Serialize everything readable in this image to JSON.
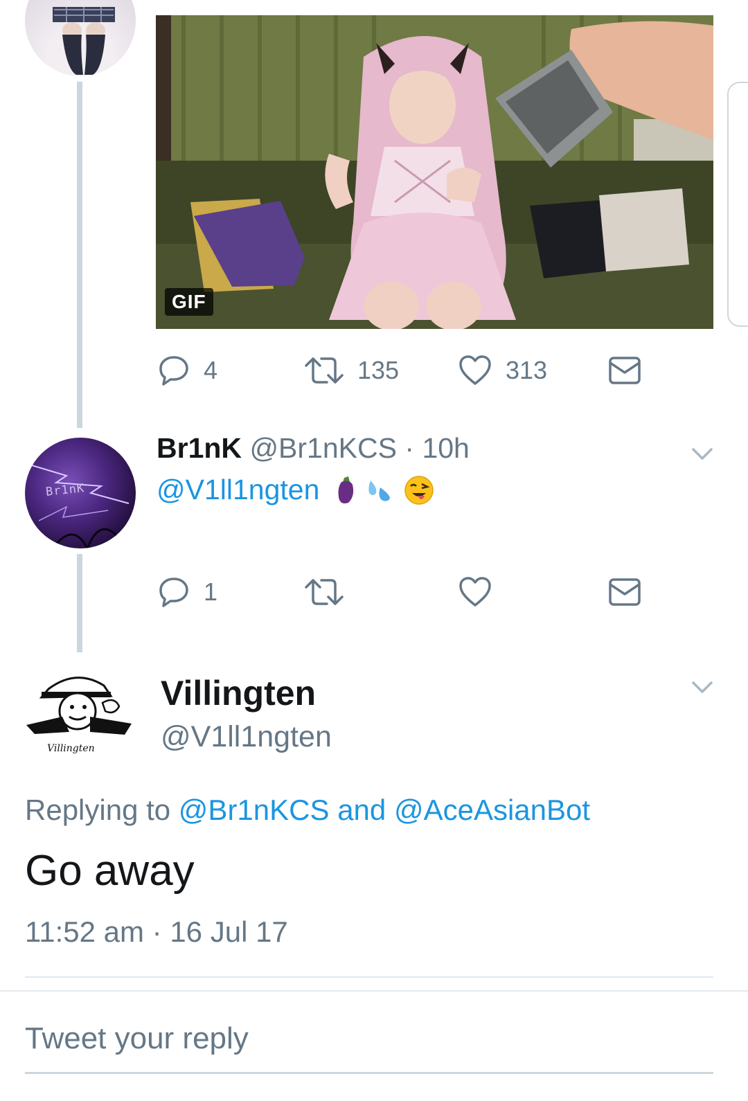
{
  "media": {
    "badge": "GIF",
    "stats": {
      "replies": "4",
      "retweets": "135",
      "likes": "313"
    }
  },
  "reply_tweet": {
    "display_name": "Br1nK",
    "handle": "@Br1nKCS",
    "separator": "·",
    "time": "10h",
    "text": "@V1ll1ngten",
    "emojis": [
      "eggplant",
      "sweat-droplets",
      "winking-face-tongue"
    ],
    "avatar_text": "Br1nK",
    "stats": {
      "replies": "1"
    }
  },
  "main_tweet": {
    "display_name": "Villingten",
    "handle": "@V1ll1ngten",
    "avatar_caption": "Villingten",
    "replying_prefix": "Replying to",
    "replying_user1": "@Br1nKCS",
    "replying_and": "and",
    "replying_user2": "@AceAsianBot",
    "text": "Go away",
    "timestamp": "11:52 am · 16 Jul 17"
  },
  "composer": {
    "placeholder": "Tweet your reply"
  },
  "colors": {
    "link": "#1b95e0",
    "muted": "#657786",
    "thread_line": "#ccd6dd"
  }
}
